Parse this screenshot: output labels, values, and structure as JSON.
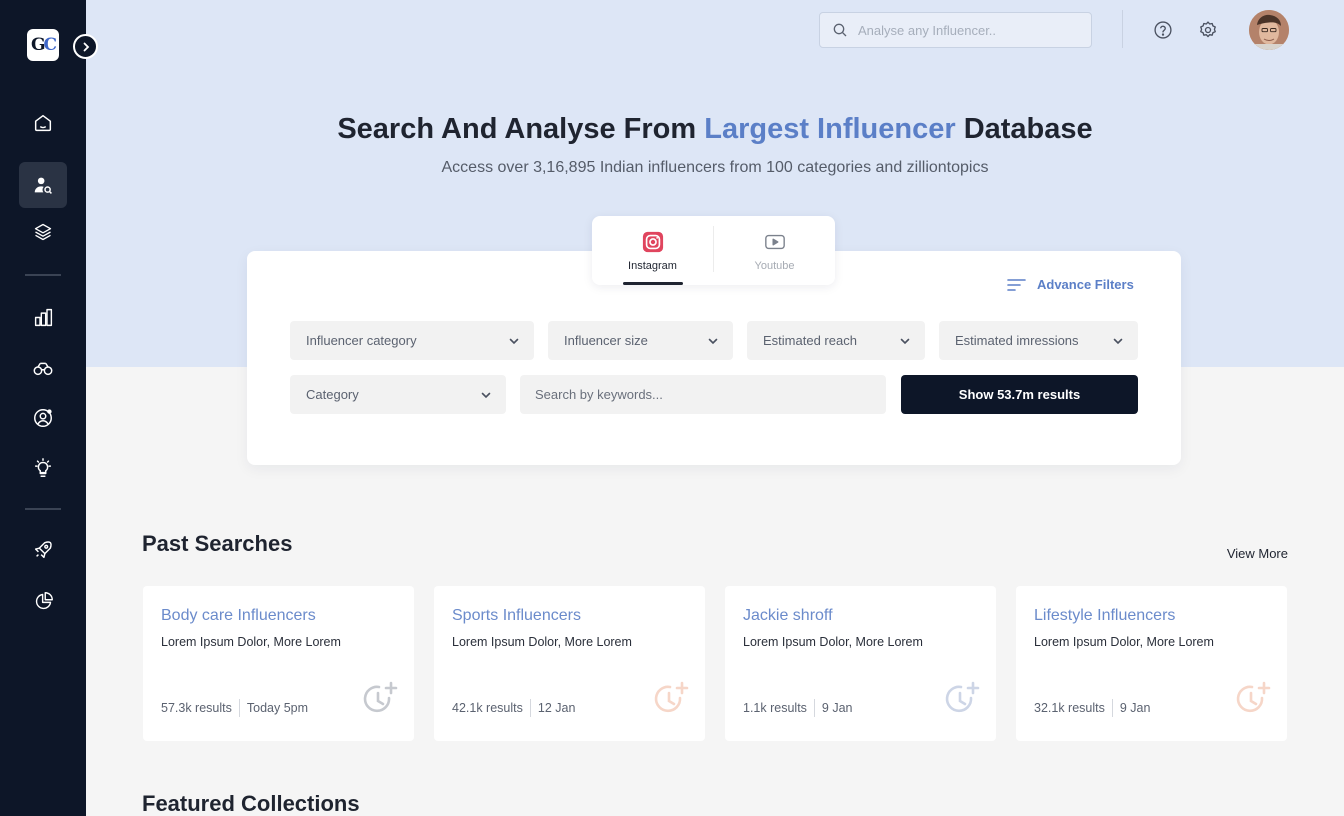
{
  "sidebar": {
    "logo": {
      "part1": "G",
      "part2": "C"
    },
    "items": [
      {
        "icon": "home-icon"
      },
      {
        "icon": "user-search-icon",
        "active": true
      },
      {
        "icon": "layers-icon"
      },
      {
        "icon": "bar-chart-icon"
      },
      {
        "icon": "binoculars-icon"
      },
      {
        "icon": "user-settings-icon"
      },
      {
        "icon": "lightbulb-icon"
      },
      {
        "icon": "rocket-icon"
      },
      {
        "icon": "pie-chart-icon"
      }
    ]
  },
  "header": {
    "search_placeholder": "Analyse any Influencer..",
    "icons": [
      "help-icon",
      "gear-icon"
    ],
    "avatar": "user-avatar"
  },
  "hero": {
    "title_pre": "Search And Analyse From ",
    "title_accent": "Largest Influencer",
    "title_post": " Database",
    "subtitle": "Access over 3,16,895 Indian influencers from 100 categories and zilliontopics"
  },
  "platform_tabs": [
    {
      "label": "Instagram",
      "icon": "instagram-icon",
      "active": true
    },
    {
      "label": "Youtube",
      "icon": "youtube-icon",
      "active": false
    }
  ],
  "filters": {
    "advance_label": "Advance Filters",
    "dropdowns": [
      "Influencer category",
      "Influencer size",
      "Estimated reach",
      "Estimated imressions",
      "Category"
    ],
    "keyword_placeholder": "Search by keywords...",
    "show_button": "Show 53.7m results"
  },
  "past_searches": {
    "title": "Past Searches",
    "view_more": "View More",
    "items": [
      {
        "title": "Body care Influencers",
        "desc": "Lorem Ipsum Dolor, More Lorem",
        "results": "57.3k results",
        "date": "Today 5pm",
        "icon_color": "#c6c9cf"
      },
      {
        "title": "Sports Influencers",
        "desc": "Lorem Ipsum Dolor, More Lorem",
        "results": "42.1k results",
        "date": "12 Jan",
        "icon_color": "#f6d6c8"
      },
      {
        "title": "Jackie shroff",
        "desc": "Lorem Ipsum Dolor, More Lorem",
        "results": "1.1k results",
        "date": "9 Jan",
        "icon_color": "#cdd5e6"
      },
      {
        "title": "Lifestyle Influencers",
        "desc": "Lorem Ipsum Dolor, More Lorem",
        "results": "32.1k results",
        "date": "9 Jan",
        "icon_color": "#f6d6c8"
      }
    ]
  },
  "featured": {
    "title": "Featured Collections"
  },
  "colors": {
    "sidebar": "#0d1628",
    "accent": "#5b7fc7",
    "hero_bg": "#dde6f6"
  }
}
